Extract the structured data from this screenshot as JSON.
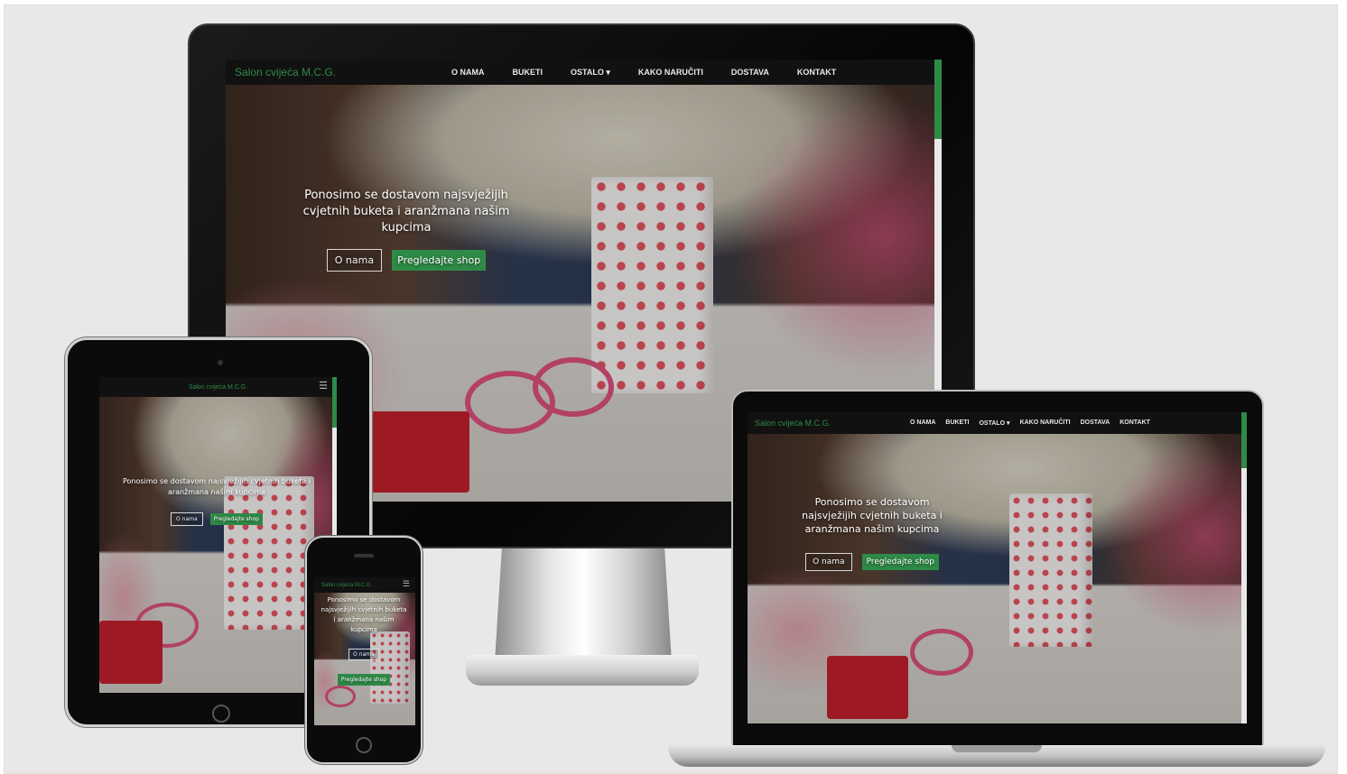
{
  "site": {
    "brand": "Salon cvijeća M.C.G.",
    "menu": [
      "O NAMA",
      "BUKETI",
      "OSTALO ▾",
      "KAKO NARUČITI",
      "DOSTAVA",
      "KONTAKT"
    ],
    "hero_text": "Ponosimo se dostavom najsvježijih cvjetnih buketa i aranžmana našim kupcima",
    "btn_about": "O nama",
    "btn_shop": "Pregledajte shop",
    "menu_icon": "hamburger-icon"
  },
  "colors": {
    "brand_green": "#2e8b47",
    "navbar": "#111111",
    "stage_bg": "#e8e8e8"
  }
}
